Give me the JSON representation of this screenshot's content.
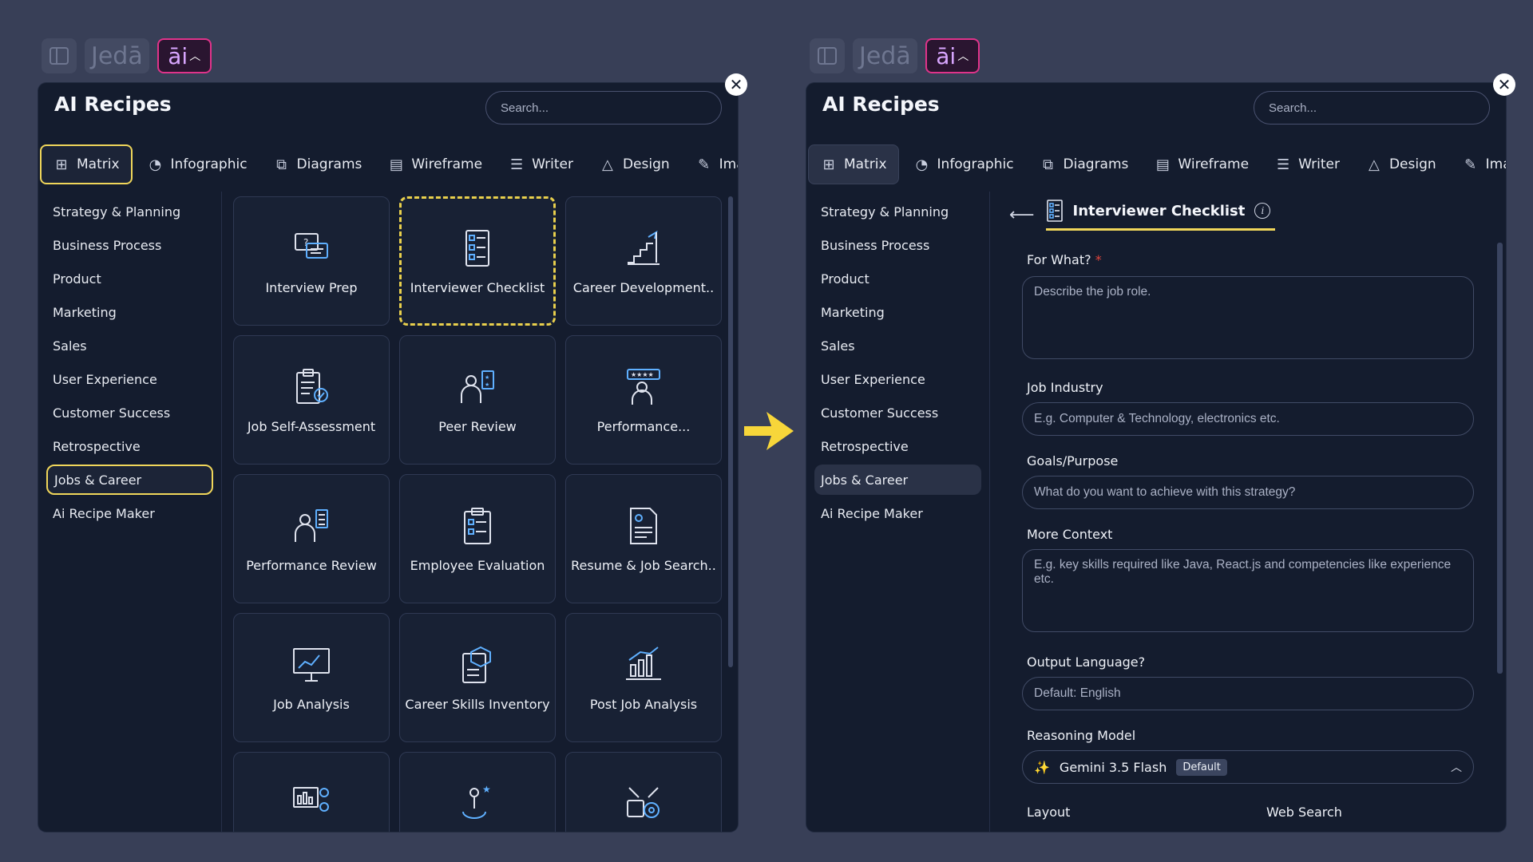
{
  "panels": [
    {
      "topbar": {
        "logo": "Jedā",
        "ai": "āi"
      },
      "title": "AI Recipes",
      "search_placeholder": "Search...",
      "tabs": [
        {
          "label": "Matrix",
          "icon": "grid-icon"
        },
        {
          "label": "Infographic",
          "icon": "pie-icon"
        },
        {
          "label": "Diagrams",
          "icon": "shapes-icon"
        },
        {
          "label": "Wireframe",
          "icon": "wireframe-icon"
        },
        {
          "label": "Writer",
          "icon": "list-icon"
        },
        {
          "label": "Design",
          "icon": "design-icon"
        },
        {
          "label": "Image",
          "icon": "brush-icon"
        }
      ],
      "sidebar": [
        "Strategy & Planning",
        "Business Process",
        "Product",
        "Marketing",
        "Sales",
        "User Experience",
        "Customer Success",
        "Retrospective",
        "Jobs & Career",
        "Ai Recipe Maker"
      ],
      "selected_category": "Jobs & Career",
      "cards": [
        "Interview Prep",
        "Interviewer Checklist",
        "Career Development..",
        "Job Self-Assessment",
        "Peer Review",
        "Performance...",
        "Performance Review",
        "Employee Evaluation",
        "Resume & Job Search..",
        "Job Analysis",
        "Career Skills Inventory",
        "Post Job Analysis"
      ],
      "highlighted_card": "Interviewer Checklist"
    },
    {
      "topbar": {
        "logo": "Jedā",
        "ai": "āi"
      },
      "title": "AI Recipes",
      "search_placeholder": "Search...",
      "tabs": [
        {
          "label": "Matrix"
        },
        {
          "label": "Infographic"
        },
        {
          "label": "Diagrams"
        },
        {
          "label": "Wireframe"
        },
        {
          "label": "Writer"
        },
        {
          "label": "Design"
        },
        {
          "label": "Image"
        }
      ],
      "sidebar": [
        "Strategy & Planning",
        "Business Process",
        "Product",
        "Marketing",
        "Sales",
        "User Experience",
        "Customer Success",
        "Retrospective",
        "Jobs & Career",
        "Ai Recipe Maker"
      ],
      "form": {
        "title": "Interviewer Checklist",
        "for_what_label": "For What?",
        "required_mark": "*",
        "for_what_placeholder": "Describe the job role.",
        "job_industry_label": "Job Industry",
        "job_industry_placeholder": "E.g. Computer & Technology, electronics etc.",
        "goals_label": "Goals/Purpose",
        "goals_placeholder": "What do you want to achieve with this strategy?",
        "context_label": "More Context",
        "context_placeholder": "E.g. key skills required like Java, React.js and competencies like experience etc.",
        "output_lang_label": "Output Language?",
        "output_lang_placeholder": "Default: English",
        "model_label": "Reasoning Model",
        "model_value": "Gemini 3.5 Flash",
        "model_badge": "Default",
        "layout_label": "Layout",
        "web_search_label": "Web Search"
      }
    }
  ],
  "colors": {
    "accent_yellow": "#f0d65a",
    "panel_bg": "#141c2e",
    "page_bg": "#383f57",
    "ai_pink": "#e0338a"
  }
}
